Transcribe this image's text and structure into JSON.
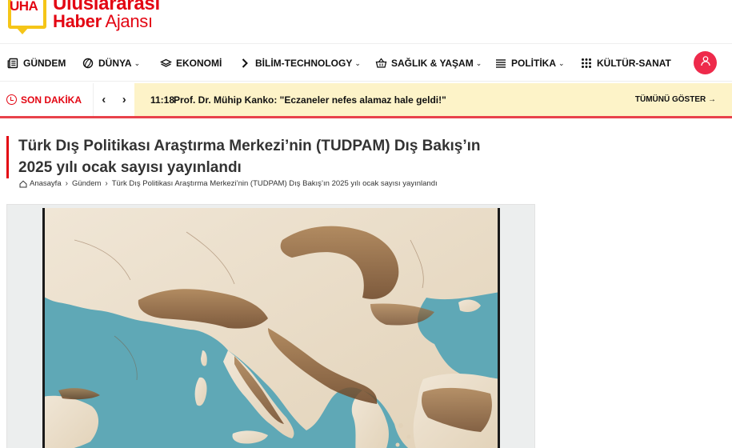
{
  "site": {
    "logo_mark": "UHA",
    "logo_line1": "Uluslararası",
    "logo_line2a": "Haber",
    "logo_line2b": " Ajansı"
  },
  "nav": {
    "items": [
      {
        "label": "GÜNDEM",
        "icon": "newspaper-icon",
        "has_dropdown": false
      },
      {
        "label": "DÜNYA",
        "icon": "globe-icon",
        "has_dropdown": true
      },
      {
        "label": "EKONOMİ",
        "icon": "money-icon",
        "has_dropdown": false
      },
      {
        "label": "BİLİM-TECHNOLOGY",
        "icon": "chevron-right-icon",
        "has_dropdown": true
      },
      {
        "label": "SAĞLIK & YAŞAM",
        "icon": "basket-icon",
        "has_dropdown": true
      },
      {
        "label": "POLİTİKA",
        "icon": "list-icon",
        "has_dropdown": true
      },
      {
        "label": "KÜLTÜR-SANAT",
        "icon": "grid-icon",
        "has_dropdown": false
      }
    ],
    "user_icon": "user-icon"
  },
  "breaking": {
    "label": "SON DAKİKA",
    "prev": "‹",
    "next": "›",
    "time": "11:18",
    "text": "Prof. Dr. Mühip Kanko: \"Eczaneler nefes alamaz hale geldi!\"",
    "see_all": "TÜMÜNÜ GÖSTER →"
  },
  "article": {
    "title": "Türk Dış Politikası Araştırma Merkezi’nin (TUDPAM) Dış Bakış’ın 2025 yılı ocak sayısı yayınlandı",
    "breadcrumb": [
      "Anasayfa",
      "Gündem",
      "Türk Dış Politikası Araştırma Merkezi’nin (TUDPAM) Dış Bakış’ın 2025 yılı ocak sayısı yayınlandı"
    ],
    "image_icon": "relief-map-of-europe-image"
  },
  "colors": {
    "brand_red": "#e30613",
    "logo_yellow": "#f5c518",
    "breaking_bg": "#fdf3c8",
    "user_button": "#ee2a4b",
    "sea": "#5fa8b6",
    "land": "#e9dcc7"
  }
}
